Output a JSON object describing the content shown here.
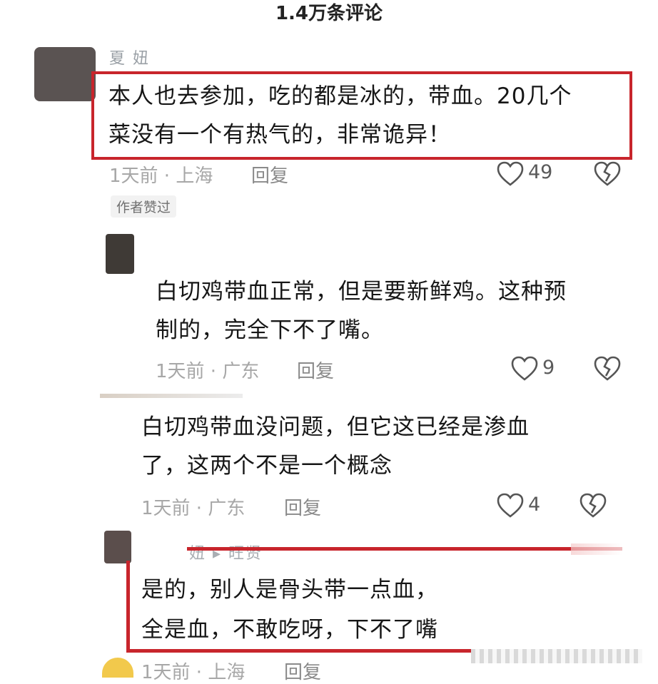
{
  "header": {
    "title": "1.4万条评论"
  },
  "comments": [
    {
      "username": "夏 妞",
      "text_line1": "本人也去参加，吃的都是冰的，带血。20几个",
      "text_line2": "菜没有一个有热气的，非常诡异！",
      "meta": "1天前 · 上海",
      "reply": "回复",
      "likes": "49",
      "badge": "作者赞过"
    },
    {
      "text_line1": "白切鸡带血正常，但是要新鲜鸡。这种预",
      "text_line2": "制的，完全下不了嘴。",
      "meta": "1天前 · 广东",
      "reply": "回复",
      "likes": "9"
    },
    {
      "text_line1": "白切鸡带血没问题，但它这已经是渗血",
      "text_line2": "了，这两个不是一个概念",
      "meta": "1天前 · 广东",
      "reply": "回复",
      "likes": "4"
    },
    {
      "username": "妞 ▸ 旺贤",
      "text_line1": "是的，别人是骨头带一点血，",
      "text_line2": "全是血，不敢吃呀，下不了嘴",
      "meta": "1天前 · 上海",
      "reply": "回复"
    }
  ],
  "icons": {
    "like": "heart-outline-icon",
    "dislike": "broken-heart-icon"
  },
  "colors": {
    "highlight": "#c8252c",
    "meta_gray": "#a7a7a7"
  }
}
